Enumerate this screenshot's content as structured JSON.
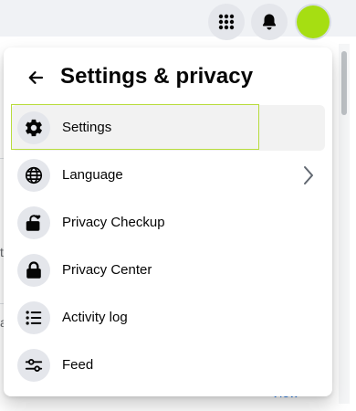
{
  "colors": {
    "page_bg": "#f0f2f5",
    "panel_bg": "#ffffff",
    "icon_bg": "#e4e6eb",
    "active_bg": "#f2f2f2",
    "focus_ring": "#b8dc3c",
    "avatar": "#a6de12",
    "link": "#1b74e4"
  },
  "topbar": {
    "menu_icon": "grid-dots-icon",
    "notifications_icon": "bell-icon",
    "avatar_icon": "avatar"
  },
  "background": {
    "glyphs": [
      "t",
      "a"
    ],
    "link_text": "View"
  },
  "panel": {
    "title": "Settings & privacy",
    "back_icon": "arrow-left-icon",
    "items": [
      {
        "label": "Settings",
        "icon": "gear-icon",
        "active": true,
        "chevron": false
      },
      {
        "label": "Language",
        "icon": "globe-icon",
        "active": false,
        "chevron": true
      },
      {
        "label": "Privacy Checkup",
        "icon": "lock-heart-icon",
        "active": false,
        "chevron": false
      },
      {
        "label": "Privacy Center",
        "icon": "lock-icon",
        "active": false,
        "chevron": false
      },
      {
        "label": "Activity log",
        "icon": "list-icon",
        "active": false,
        "chevron": false
      },
      {
        "label": "Feed",
        "icon": "sliders-icon",
        "active": false,
        "chevron": false
      }
    ]
  }
}
